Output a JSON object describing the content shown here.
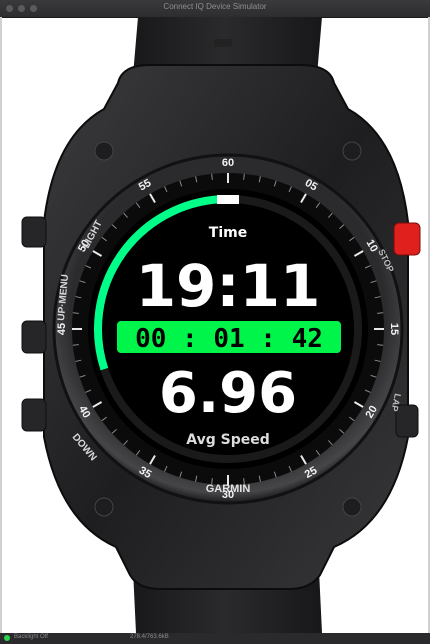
{
  "window": {
    "title": "Connect IQ Device Simulator"
  },
  "watch": {
    "brand": "GARMIN",
    "buttons": {
      "light": "LIGHT",
      "up_menu": "UP·MENU",
      "down": "DOWN",
      "start_stop": "STOP",
      "lap": "LAP"
    },
    "bezel_numbers": [
      "60",
      "05",
      "10",
      "15",
      "20",
      "25",
      "30",
      "35",
      "40",
      "45",
      "50",
      "55"
    ],
    "screen": {
      "top_label": "Time",
      "time": "19:11",
      "timer": "00 : 01 : 42",
      "value": "6.96",
      "bottom_label": "Avg Speed",
      "progress": 0.3
    }
  },
  "status": {
    "backlight": "Backlight Off",
    "memory": "278.4/763.6kB"
  },
  "colors": {
    "accent": "#00ff88",
    "timer_bg": "#00f54a",
    "start_button": "#e0201c"
  }
}
